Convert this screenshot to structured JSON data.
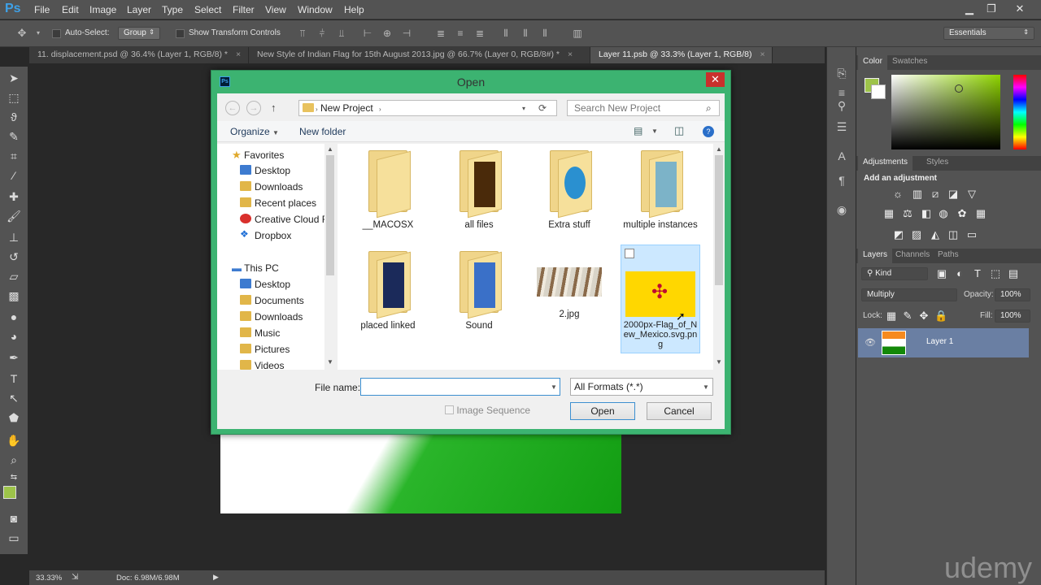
{
  "menubar": {
    "logo": "Ps",
    "items": [
      "File",
      "Edit",
      "Image",
      "Layer",
      "Type",
      "Select",
      "Filter",
      "View",
      "Window",
      "Help"
    ],
    "minimize": "▁",
    "restore": "❐",
    "close": "✕"
  },
  "options": {
    "auto_select_label": "Auto-Select:",
    "auto_select_value": "Group",
    "transform_label": "Show Transform Controls",
    "workspace": "Essentials"
  },
  "tabs": [
    {
      "label": "11. displacement.psd @ 36.4% (Layer 1, RGB/8) *"
    },
    {
      "label": "New Style of Indian Flag for 15th August 2013.jpg @ 66.7% (Layer 0, RGB/8#) *"
    },
    {
      "label": "Layer 11.psb @ 33.3% (Layer 1, RGB/8)"
    }
  ],
  "tab_close": "×",
  "status": {
    "zoom": "33.33%",
    "doc": "Doc: 6.98M/6.98M"
  },
  "panels": {
    "color_tab": "Color",
    "swatches_tab": "Swatches",
    "adjustments_tab": "Adjustments",
    "styles_tab": "Styles",
    "add_adjustment": "Add an adjustment",
    "layers_tab": "Layers",
    "channels_tab": "Channels",
    "paths_tab": "Paths",
    "kind": "Kind",
    "blend_mode": "Multiply",
    "opacity_label": "Opacity:",
    "opacity_value": "100%",
    "lock_label": "Lock:",
    "fill_label": "Fill:",
    "fill_value": "100%",
    "layer_name": "Layer 1"
  },
  "colors": {
    "foreground": "#9dc34a",
    "accent_green": "#3cb371"
  },
  "dialog": {
    "title": "Open",
    "close": "✕",
    "breadcrumb": "New Project",
    "search_placeholder": "Search New Project",
    "organize": "Organize",
    "new_folder": "New folder",
    "nav": {
      "favorites": "Favorites",
      "fav_items": [
        "Desktop",
        "Downloads",
        "Recent places",
        "Creative Cloud Fi",
        "Dropbox"
      ],
      "this_pc": "This PC",
      "pc_items": [
        "Desktop",
        "Documents",
        "Downloads",
        "Music",
        "Pictures",
        "Videos"
      ]
    },
    "files": [
      "__MACOSX",
      "all files",
      "Extra stuff",
      "multiple instances",
      "placed linked",
      "Sound",
      "2.jpg",
      "2000px-Flag_of_New_Mexico.svg.png"
    ],
    "file_name_label": "File name:",
    "file_name_value": "",
    "file_type": "All Formats (*.*)",
    "image_sequence": "Image Sequence",
    "open_button": "Open",
    "cancel_button": "Cancel"
  },
  "watermark": "udemy"
}
